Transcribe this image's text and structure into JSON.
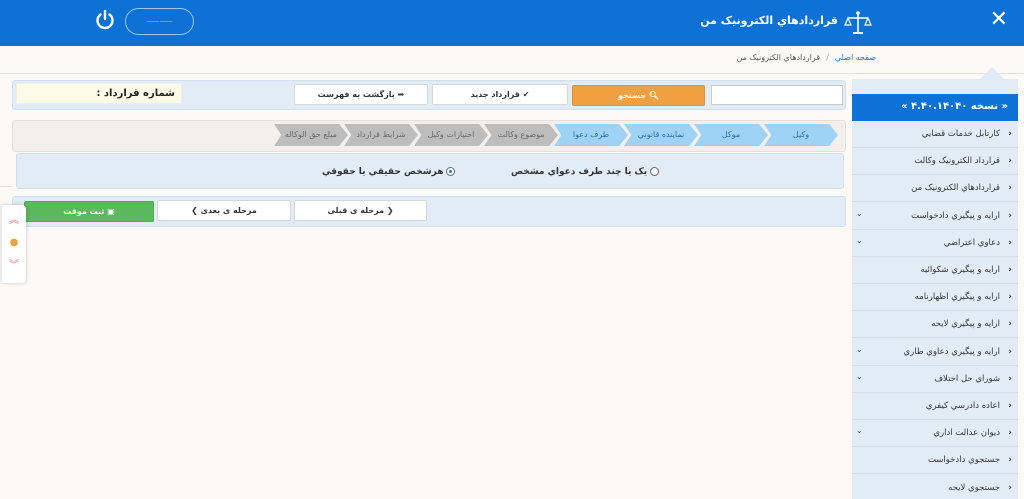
{
  "header": {
    "close_glyph": "✕",
    "app_title": "قراردادهاي الکترونيک من",
    "user_button": "⸺⸺",
    "logo_icon": "scales-icon"
  },
  "breadcrumb": {
    "home": "صفحه اصلي",
    "separator": "/",
    "current": "قراردادهاي الکترونيک من"
  },
  "toolbar": {
    "search_label": "جستجو",
    "new_contract_label": "قرارداد جديد",
    "back_to_list_label": "بازگشت به فهرست",
    "contract_number_label": "شماره قرارداد :",
    "search_value": ""
  },
  "steps": [
    {
      "label": "وکيل",
      "active": true
    },
    {
      "label": "موکل",
      "active": true
    },
    {
      "label": "نماينده قانوني",
      "active": true
    },
    {
      "label": "طرف دعوا",
      "active": true
    },
    {
      "label": "موضوع وکالت",
      "active": false
    },
    {
      "label": "اختيارات وکيل",
      "active": false
    },
    {
      "label": "شرايط قرارداد",
      "active": false
    },
    {
      "label": "مبلغ حق الوکاله",
      "active": false
    }
  ],
  "radio_options": {
    "option1": "يک يا چند طرف دعواي مشخص",
    "option2": "هرشخص حقيقي يا حقوقي",
    "selected": "option2"
  },
  "navigation": {
    "prev_label": "مرحله ی قبلی",
    "next_label": "مرحله ی بعدی",
    "save_label": "ثبت موقت"
  },
  "sidebar": {
    "version": "« نسخه ۴.۴۰.۱۴۰۴۰ »",
    "items": [
      {
        "label": "کارتابل خدمات قضايي",
        "expandable": false
      },
      {
        "label": "قرارداد الکترونيک وکالت",
        "expandable": false
      },
      {
        "label": "قراردادهاي الکترونيک من",
        "expandable": false
      },
      {
        "label": "ارايه و پيگيري دادخواست",
        "expandable": true
      },
      {
        "label": "دعاوي اعتراضي",
        "expandable": true
      },
      {
        "label": "ارايه و پيگيري شکوائيه",
        "expandable": false
      },
      {
        "label": "ارايه و پيگيري اظهارنامه",
        "expandable": false
      },
      {
        "label": "ارايه و پيگيري لايحه",
        "expandable": false
      },
      {
        "label": "ارايه و پيگيري دعاوي طاري",
        "expandable": true
      },
      {
        "label": "شوراي حل اختلاف",
        "expandable": true
      },
      {
        "label": "اعاده دادرسي کيفري",
        "expandable": false
      },
      {
        "label": "ديوان عدالت اداري",
        "expandable": true
      },
      {
        "label": "جستجوي دادخواست",
        "expandable": false
      },
      {
        "label": "جستجوي لايحه",
        "expandable": false
      }
    ]
  },
  "colors": {
    "brand_blue": "#0e71d6",
    "search_orange": "#f0a040",
    "save_green": "#5cb85c",
    "active_step": "#9ed3f5",
    "inactive_step": "#bdbdbd"
  }
}
